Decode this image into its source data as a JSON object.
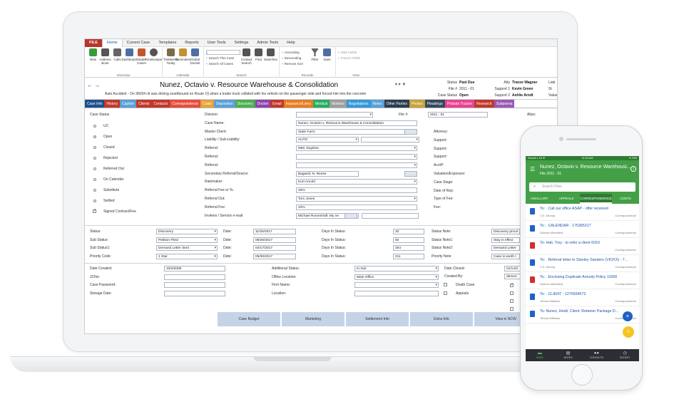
{
  "menu": {
    "file": "FILE",
    "items": [
      "Home",
      "Current Case",
      "Templates",
      "Reports",
      "User Tools",
      "Settings",
      "Admin Tools",
      "Help"
    ]
  },
  "ribbon": {
    "buttons": [
      {
        "label": "New",
        "icon": "new-icon",
        "color": "#3a9b3a"
      },
      {
        "label": "Address Book",
        "icon": "address-book-icon",
        "color": "#555"
      },
      {
        "label": "Calls",
        "icon": "calls-icon",
        "color": "#666"
      },
      {
        "label": "Dashboard",
        "icon": "dashboard-icon",
        "color": "#4f6fa3"
      },
      {
        "label": "Intake Cases",
        "icon": "intake-icon",
        "color": "#c2572c"
      },
      {
        "label": "TimeKeeper",
        "icon": "timekeeper-icon",
        "color": "#555"
      }
    ],
    "overview": "Overview",
    "calendar_buttons": [
      {
        "label": "TrialWorks Today",
        "icon": "today-icon",
        "color": "#7b6b4a"
      },
      {
        "label": "Reminders",
        "icon": "reminders-icon",
        "color": "#c7902f"
      },
      {
        "label": "Global Docket",
        "icon": "docket-icon",
        "color": "#4f6fa3"
      }
    ],
    "calendar": "Calendar",
    "search_items": [
      "Search This Case",
      "Search All Cases"
    ],
    "search_buttons": [
      {
        "label": "Contact Search",
        "icon": "contact-search-icon",
        "color": "#555"
      },
      {
        "label": "Find",
        "icon": "find-icon",
        "color": "#555"
      },
      {
        "label": "Searches",
        "icon": "searches-icon",
        "color": "#555"
      }
    ],
    "search": "Search",
    "sort_items": [
      "Ascending",
      "Descending",
      "Remove Sort"
    ],
    "filter": "Filter",
    "save": "Save",
    "records": "Records",
    "view_items": [
      "Hide Fields",
      "Freeze Fields"
    ],
    "view": "View"
  },
  "case": {
    "title": "Nunez, Octavio v. Resource Warehouse & Consolidation",
    "subtitle": "Auto Accident - On 9/6/94 clt was driving southbound on Route 1§ when a trailer truck collided with his vehicle on the passenger side and forced him into the concrete",
    "status_label": "Status",
    "status": "Past Due",
    "file_label": "File #",
    "file": "2011 - 01",
    "case_status_label": "Case Status",
    "case_status": "Open",
    "atty_label": "Atty",
    "atty": "Tracee Wagner",
    "support1_label": "Support 1",
    "support1": "Kevin Green",
    "support2_label": "Support 2",
    "support2": "Ashlie Arndt",
    "liab_label": "Liab",
    "s_label": "St",
    "value_label": "Value"
  },
  "tabs": [
    {
      "label": "Case Info",
      "color": "#1f4f8f"
    },
    {
      "label": "History",
      "color": "#c0392b"
    },
    {
      "label": "Caption",
      "color": "#5aa0d8"
    },
    {
      "label": "Clients",
      "color": "#c0392b"
    },
    {
      "label": "Contacts",
      "color": "#c0392b"
    },
    {
      "label": "Correspondence",
      "color": "#e74c3c"
    },
    {
      "label": "Costs",
      "color": "#e6a23c"
    },
    {
      "label": "Deposition",
      "color": "#5aa0d8"
    },
    {
      "label": "Discovery",
      "color": "#4caf50"
    },
    {
      "label": "Docket",
      "color": "#8e44ad"
    },
    {
      "label": "Email",
      "color": "#c0392b"
    },
    {
      "label": "Insurance/Liens",
      "color": "#e67e22"
    },
    {
      "label": "Medical",
      "color": "#27ae60"
    },
    {
      "label": "Motions",
      "color": "#9e9e9e"
    },
    {
      "label": "Negotiations",
      "color": "#3498db"
    },
    {
      "label": "Notes",
      "color": "#5aa0d8"
    },
    {
      "label": "Other Parties",
      "color": "#2c3e50"
    },
    {
      "label": "Photos",
      "color": "#c8a33a"
    },
    {
      "label": "Pleadings",
      "color": "#34495e"
    },
    {
      "label": "Probate Tracker",
      "color": "#e84393"
    },
    {
      "label": "Research",
      "color": "#c0392b"
    },
    {
      "label": "Subpoena",
      "color": "#9b59b6"
    }
  ],
  "form": {
    "case_status_label": "Case Status",
    "statuses": [
      "UC",
      "Open",
      "Closed",
      "Rejected",
      "Referred Out",
      "On Calendar",
      "Substitute",
      "Settled",
      "Signed Contract/Fee"
    ],
    "selected_status": "Open",
    "fields": [
      {
        "label": "Division:",
        "value": ""
      },
      {
        "label": "Case Name:",
        "value": "Nunez, Octavio v. Resource Warehouse & Consolidation"
      },
      {
        "label": "Master Client:",
        "value": "State Farm"
      },
      {
        "label": "Liability / Sub-Liability:",
        "value": "AUTO"
      },
      {
        "label": "Referral:",
        "value": "NBC Daytime"
      },
      {
        "label": "Referral:",
        "value": ""
      },
      {
        "label": "Referral:",
        "value": ""
      },
      {
        "label": "Secondary Referral/Source:",
        "value": "Bagwell, N. Reese"
      },
      {
        "label": "Rainmaker:",
        "value": "Kurt Arnold"
      },
      {
        "label": "Referral Fee or %:",
        "value": "20%"
      },
      {
        "label": "Referral Out:",
        "value": "Tom Jones"
      },
      {
        "label": "Referral Fee:",
        "value": "10%"
      },
      {
        "label": "Invitees / Service e-mail:",
        "value": "Michael Romenhaft: My ne"
      }
    ],
    "file_label": "File #:",
    "file_value": "2011 - 01",
    "alias_label": "Alias:",
    "right_labels": [
      "Attorney:",
      "Support:",
      "Support:",
      "Support:",
      "AcctP:",
      "Valuation/Exposure:",
      "Case Stage:",
      "Date of Rep:",
      "Type of Fee:",
      "Fee:"
    ],
    "status_rows": [
      {
        "label": "Status:",
        "value": "Discovery",
        "date": "11/25/2017",
        "days": "32",
        "note_label": "Status Note:",
        "note": "Discovery proce"
      },
      {
        "label": "Sub Status:",
        "value": "Petition Filed",
        "date": "09/26/2017",
        "days": "92",
        "note_label": "Status Note1:",
        "note": "Stay in effect"
      },
      {
        "label": "Sub Status1:",
        "value": "Demand Letter Sent",
        "date": "04/17/2017",
        "days": "254",
        "note_label": "Status Note2:",
        "note": "Demand Letter"
      },
      {
        "label": "Priority Code",
        "value": "1 Star",
        "date": "05/30/2017",
        "days": "211",
        "note_label": "Priority Note",
        "note": "Case is worth t"
      }
    ],
    "date_label": "Date:",
    "days_label": "Days In Status:",
    "lower_left": [
      {
        "label": "Date Created:",
        "value": "10/2/2009"
      },
      {
        "label": "JCNo:",
        "value": ""
      },
      {
        "label": "Case Password:",
        "value": ""
      },
      {
        "label": "Storage Date:",
        "value": ""
      }
    ],
    "lower_mid": [
      {
        "label": "Additional Status:",
        "value": "In Suit"
      },
      {
        "label": "Office Location:",
        "value": "Main Office"
      },
      {
        "label": "Firm Name:",
        "value": ""
      },
      {
        "label": "Location:",
        "value": ""
      }
    ],
    "date_closed_label": "Date Closed:",
    "date_closed": "01/14/2",
    "created_by_label": "Created By:",
    "created_by": "demo1",
    "death_case": "Death Case",
    "appeals": "Appeals",
    "bottom_buttons": [
      "Case Budget",
      "Marketing",
      "Settlement Info",
      "Extra Info",
      "View in NCW"
    ]
  },
  "phone": {
    "status_left": "Search ▪ 15 ▼",
    "status_time": "11:03 AM",
    "status_right": "▾ 74%",
    "title": "Nunez, Octavio v. Resource Warehousi...",
    "subtitle": "File 2011 - 01",
    "search_placeholder": "Search Files",
    "tabs": [
      "ANCILLARY",
      "APPEALS",
      "CORRESPONDENCE",
      "COSTS"
    ],
    "items": [
      {
        "title": "To: . Call our office ASAP - offer received",
        "who": "C.E. Murray",
        "cat": "Correspondence",
        "icon_color": "#1e63c4"
      },
      {
        "title": "To: . CALENDAR - 175365217",
        "who": "Dolores Mansfield",
        "cat": "Correspondence",
        "icon_color": "#1e63c4"
      },
      {
        "title": "To: Hall, Troy - to refer a client 6010",
        "who": "",
        "cat": "Correspondence",
        "icon_color": "#d32f2f"
      },
      {
        "title": "To: . Referral letter to Stanley Sanders (VIOXX) - 7...",
        "who": "C.E. Murray",
        "cat": "Correspondence",
        "icon_color": "#1e63c4"
      },
      {
        "title": "To: . Enclosing Duplicate Annuity Policy 11650",
        "who": "Dolores Mansfield",
        "cat": "Correspondence",
        "icon_color": "#d32f2f"
      },
      {
        "title": "To: . CLIENT - 1270934572",
        "who": "Teresa Williams",
        "cat": "Correspondence",
        "icon_color": "#1e63c4"
      },
      {
        "title": "To: Nunez, Heidi, Client: Retainer Package D...",
        "who": "Teresa Williams",
        "cat": "Correspondence",
        "icon_color": "#1e63c4"
      }
    ],
    "nav": [
      "FILES",
      "NOTES",
      "CONTACTS",
      "DOCKET"
    ]
  }
}
